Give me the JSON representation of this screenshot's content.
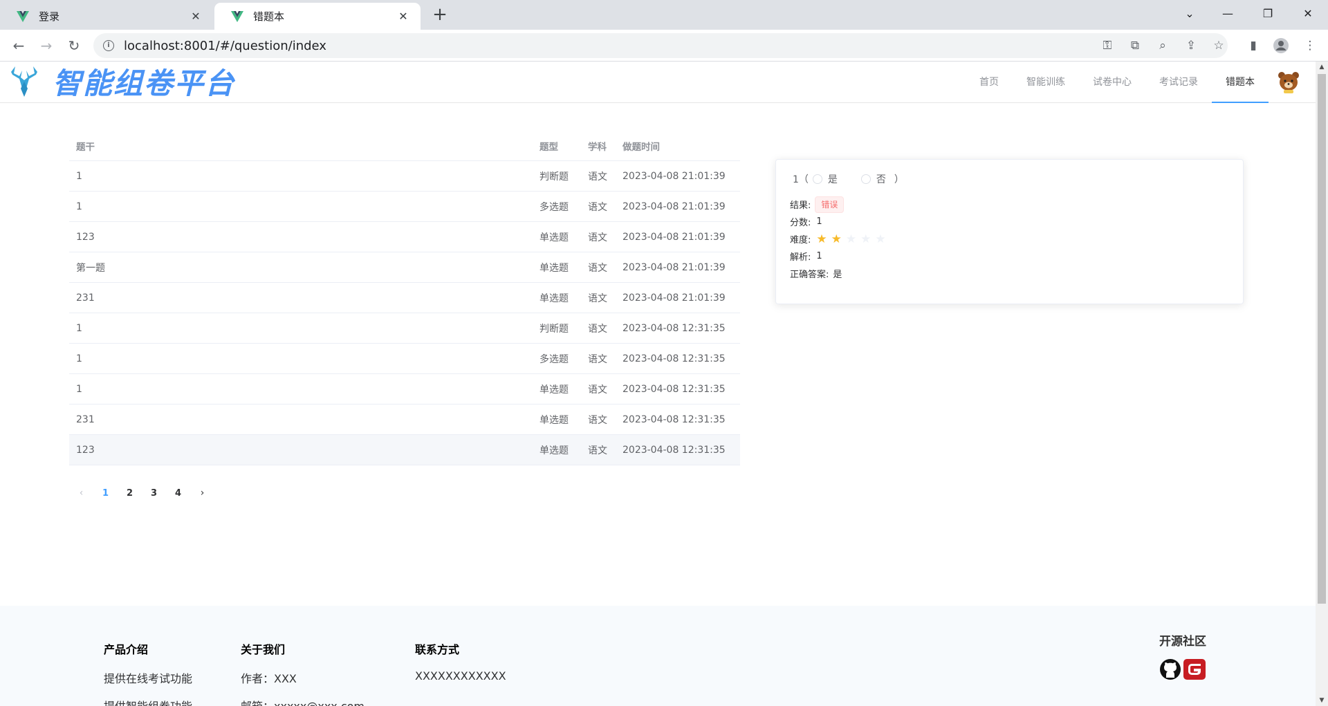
{
  "browser": {
    "tabs": [
      {
        "title": "登录",
        "active": false
      },
      {
        "title": "错题本",
        "active": true
      }
    ],
    "url": "localhost:8001/#/question/index"
  },
  "header": {
    "logo_text": "智能组卷平台",
    "menu": [
      "首页",
      "智能训练",
      "试卷中心",
      "考试记录",
      "错题本"
    ],
    "active_menu": "错题本"
  },
  "table": {
    "columns": [
      "题干",
      "题型",
      "学科",
      "做题时间"
    ],
    "rows": [
      {
        "stem": "1",
        "type": "判断题",
        "subject": "语文",
        "time": "2023-04-08 21:01:39"
      },
      {
        "stem": "1",
        "type": "多选题",
        "subject": "语文",
        "time": "2023-04-08 21:01:39"
      },
      {
        "stem": "123",
        "type": "单选题",
        "subject": "语文",
        "time": "2023-04-08 21:01:39"
      },
      {
        "stem": "第一题",
        "type": "单选题",
        "subject": "语文",
        "time": "2023-04-08 21:01:39"
      },
      {
        "stem": "231",
        "type": "单选题",
        "subject": "语文",
        "time": "2023-04-08 21:01:39"
      },
      {
        "stem": "1",
        "type": "判断题",
        "subject": "语文",
        "time": "2023-04-08 12:31:35"
      },
      {
        "stem": "1",
        "type": "多选题",
        "subject": "语文",
        "time": "2023-04-08 12:31:35"
      },
      {
        "stem": "1",
        "type": "单选题",
        "subject": "语文",
        "time": "2023-04-08 12:31:35"
      },
      {
        "stem": "231",
        "type": "单选题",
        "subject": "语文",
        "time": "2023-04-08 12:31:35"
      },
      {
        "stem": "123",
        "type": "单选题",
        "subject": "语文",
        "time": "2023-04-08 12:31:35"
      }
    ]
  },
  "pagination": {
    "pages": [
      "1",
      "2",
      "3",
      "4"
    ],
    "current": "1"
  },
  "detail": {
    "question_prefix": "1（",
    "question_suffix": "）",
    "options": [
      "是",
      "否"
    ],
    "result_label": "结果:",
    "result_value": "错误",
    "score_label": "分数:",
    "score_value": "1",
    "difficulty_label": "难度:",
    "difficulty_value": 2,
    "difficulty_max": 5,
    "analysis_label": "解析:",
    "analysis_value": "1",
    "answer_label": "正确答案:",
    "answer_value": "是"
  },
  "footer": {
    "product_title": "产品介绍",
    "product_lines": [
      "提供在线考试功能",
      "提供智能组卷功能"
    ],
    "about_title": "关于我们",
    "about_lines": [
      "作者：XXX",
      "邮箱：xxxxx@xxx.com"
    ],
    "contact_title": "联系方式",
    "contact_value": "XXXXXXXXXXXX",
    "community_title": "开源社区"
  },
  "colors": {
    "accent": "#409eff",
    "logo": "#4a93f5",
    "star": "#f7ba2a",
    "error": "#f56c6c"
  }
}
